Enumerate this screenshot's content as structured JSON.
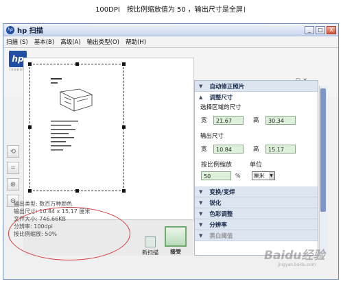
{
  "caption": "100DPI　按比例缩放值为 50 ，输出尺寸是全屏",
  "window": {
    "title": "hp  扫描",
    "controls": {
      "minimize": "_",
      "maximize": "□",
      "close": "X"
    }
  },
  "menu": [
    "扫描 (S)",
    "基本(B)",
    "高级(A)",
    "输出类型(O)",
    "帮助(H)"
  ],
  "logo": {
    "text": "hp",
    "tagline": "invent"
  },
  "info": {
    "output_type": "输出类型: 数百万种颜色",
    "output_size": "输出尺寸: 10.84 x 15.17 厘米",
    "file_size": "文件大小: 746.66KB",
    "resolution": "分辨率: 100dpi",
    "scale": "按比例缩放: 50%"
  },
  "buttons": {
    "new_scan": "新扫描",
    "accept": "接受"
  },
  "panel": {
    "auto_fix": "自动修正照片",
    "resize": "调整尺寸",
    "select_region_size": "选择区域的尺寸",
    "width_label": "宽",
    "height_label": "高",
    "region_width": "21.67",
    "region_height": "30.34",
    "output_size_label": "输出尺寸",
    "out_width": "10.84",
    "out_height": "15.17",
    "scale_label": "按比例缩放",
    "unit_label": "单位",
    "scale_value": "50",
    "pct": "%",
    "unit_value": "厘米",
    "sections": [
      "变换/变焊",
      "锐化",
      "色彩调整",
      "分辨率",
      "黑白阈值"
    ]
  },
  "watermark": {
    "main": "Baidu经验",
    "sub": "jingyan.baidu.com"
  }
}
